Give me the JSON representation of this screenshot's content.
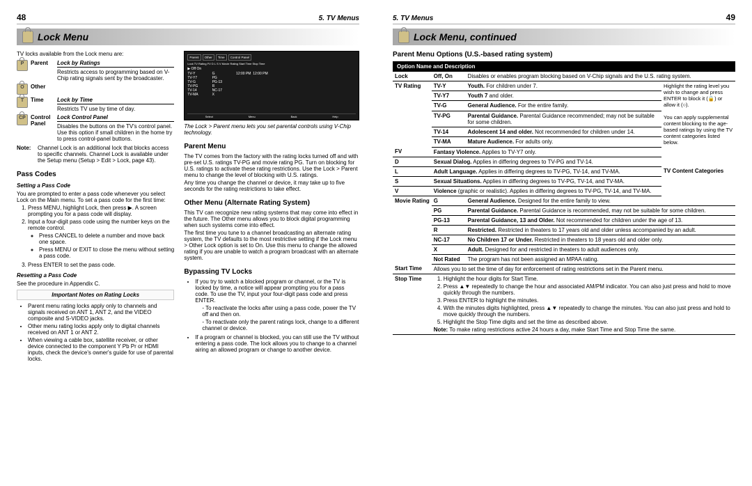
{
  "pages": {
    "left": {
      "num": "48",
      "section": "5. TV Menus",
      "title": "Lock Menu"
    },
    "right": {
      "num": "49",
      "section": "5. TV Menus",
      "title": "Lock Menu, continued"
    }
  },
  "intro": "TV locks available from the Lock menu are:",
  "lockTypes": [
    {
      "ltr": "P",
      "label": "Parent",
      "hd": "Lock by Ratings",
      "desc": "Restricts access to programming based on V-Chip rating signals sent by the broadcaster."
    },
    {
      "ltr": "O",
      "label": "Other",
      "hd": "",
      "desc": ""
    },
    {
      "ltr": "T",
      "label": "Time",
      "hd": "Lock by Time",
      "desc": "Restricts TV use by time of day."
    },
    {
      "ltr": "CP",
      "label": "Control Panel",
      "hd": "Lock Control Panel",
      "desc": "Disables the buttons on the TV's control panel. Use this option if small children in the home try to press control-panel buttons."
    }
  ],
  "note1": {
    "label": "Note:",
    "text": "Channel Lock is an additional lock that blocks access to specific channels. Channel Lock is available under the Setup menu (Setup > Edit > Lock, page 43)."
  },
  "passCodes": {
    "hd": "Pass Codes",
    "settingHd": "Setting a Pass Code",
    "settingTxt": "You are prompted to enter a pass code whenever you select Lock on the Main menu. To set a pass code for the first time:",
    "steps": [
      "Press MENU, highlight Lock, then press ▶. A screen prompting you for a pass code will display.",
      "Input a four-digit pass code using the number keys on the remote control.",
      "Press ENTER to set the pass code."
    ],
    "bullets": [
      "Press CANCEL to delete a number and move back one space.",
      "Press MENU or EXIT to close the menu without setting a pass code."
    ],
    "resetHd": "Resetting a Pass Code",
    "resetTxt": "See the procedure in Appendix C."
  },
  "impNotes": {
    "hd": "Important Notes on Rating Locks",
    "items": [
      "Parent menu rating locks apply only to channels and signals received on ANT 1, ANT 2, and the VIDEO composite and S-VIDEO jacks.",
      "Other menu rating locks apply only to digital channels received on ANT 1 or ANT 2.",
      "When viewing a cable box, satellite receiver, or other device connected to the component Y Pb Pr or HDMI inputs, check the device's owner's guide for use of parental locks."
    ]
  },
  "screenCaption": "The Lock > Parent menu lets you set parental controls using V-Chip technology.",
  "scr": {
    "tabs": [
      "Parent",
      "Other",
      "Time",
      "Control Panel"
    ],
    "cols": "Lock  TV Rating  FV  D  L  S  V  Movie Rating  Start Time  Stop Time",
    "offon": "▶ Off    On",
    "ratingsL": [
      "TV-Y",
      "TV-Y7",
      "TV-G",
      "TV-PG",
      "TV-14",
      "TV-MA"
    ],
    "mv": [
      "G",
      "PG",
      "PG-13",
      "R",
      "NC-17",
      "X"
    ],
    "t1": "12:00 PM",
    "t2": "12:00 PM",
    "b": [
      "Select",
      "Menu",
      "Back",
      "Help"
    ]
  },
  "parentMenu": {
    "hd": "Parent Menu",
    "p1": "The TV comes from the factory with the rating locks turned off and with pre-set U.S. ratings TV-PG and movie rating PG. Turn on blocking for U.S. ratings to activate these rating restrictions. Use the Lock > Parent menu to change the level of blocking with U.S. ratings.",
    "p2": "Any time you change the channel or device, it may take up to five seconds for the rating restrictions to take effect."
  },
  "otherMenu": {
    "hd": "Other Menu (Alternate Rating System)",
    "p1": "This TV can recognize new rating systems that may come into effect in the future. The Other menu allows you to block digital programming when such systems come into effect.",
    "p2": "The first time you tune to a channel broadcasting an alternate rating system, the TV defaults to the most restrictive setting if the Lock menu > Other Lock option is set to On. Use this menu to change the allowed rating if you are unable to watch a program broadcast with an alternate system."
  },
  "bypass": {
    "hd": "Bypassing TV Locks",
    "b1": "If you try to watch a blocked program or channel, or the TV is locked by time, a notice will appear prompting you for a pass code. To use the TV, input your four-digit pass code and press ENTER.",
    "sub1": "To reactivate the locks after using a pass code, power the TV off and then on.",
    "sub2": "To reactivate only the parent ratings lock, change to a different channel or device.",
    "b2": "If a program or channel is blocked, you can still use the TV without entering a pass code. The lock allows you to change to a channel airing an allowed program or change to another device."
  },
  "rightHd": "Parent Menu Options (U.S.-based rating system)",
  "tblHd": "Option Name and Description",
  "lockRow": {
    "k": "Lock",
    "v": "Off, On",
    "d": "Disables or enables program blocking based on V-Chip signals and the U.S. rating system."
  },
  "tv_side": {
    "p1": "Highlight the rating level you wish to change and press ENTER to block it (",
    "ic1": "🔒",
    "mid": ") or allow it (",
    "ic2": "⦰",
    "p2": ").",
    "p3": "You can apply supplemental content blocking to the age-based ratings by using the TV content categories listed below."
  },
  "tvRating": [
    {
      "k": "TV-Y",
      "b": "Youth.",
      "d": "For children under 7."
    },
    {
      "k": "TV-Y7",
      "b": "Youth 7",
      "d": " and older."
    },
    {
      "k": "TV-G",
      "b": "General Audience.",
      "d": "For the entire family."
    },
    {
      "k": "TV-PG",
      "b": "Parental Guidance.",
      "d": "Parental Guidance recommended; may not be suitable for some children."
    },
    {
      "k": "TV-14",
      "b": "Adolescent 14 and older.",
      "d": "Not recommended for children under 14."
    },
    {
      "k": "TV-MA",
      "b": "Mature Audience.",
      "d": "For adults only."
    }
  ],
  "tvRatingLabel": "TV Rating",
  "tcHd": "TV Content Categories",
  "content": [
    {
      "k": "FV",
      "b": "Fantasy Violence.",
      "d": "Applies to TV-Y7 only."
    },
    {
      "k": "D",
      "b": "Sexual Dialog.",
      "d": "Applies in differing degrees to TV-PG and TV-14."
    },
    {
      "k": "L",
      "b": "Adult Language.",
      "d": "Applies in differing degrees to TV-PG, TV-14, and TV-MA."
    },
    {
      "k": "S",
      "b": "Sexual Situations.",
      "d": "Applies in differing degrees to TV-PG, TV-14, and TV-MA."
    },
    {
      "k": "V",
      "b": "Violence",
      "d": " (graphic or realistic). Applies in differing degrees to TV-PG, TV-14, and TV-MA."
    }
  ],
  "movieLabel": "Movie Rating",
  "movie": [
    {
      "k": "G",
      "b": "General Audience.",
      "d": "Designed for the entire family to view."
    },
    {
      "k": "PG",
      "b": "Parental Guidance.",
      "d": "Parental Guidance is recommended, may not be suitable for some children."
    },
    {
      "k": "PG-13",
      "b": "Parental Guidance, 13 and Older.",
      "d": "Not recommended for children under the age of 13."
    },
    {
      "k": "R",
      "b": "Restricted.",
      "d": "Restricted in theaters to 17 years old and older unless accompanied by an adult."
    },
    {
      "k": "NC-17",
      "b": "No Children 17 or Under.",
      "d": "Restricted in theaters to 18 years old and older only."
    },
    {
      "k": "X",
      "b": "Adult.",
      "d": "Designed for and restricted in theaters to adult audiences only."
    },
    {
      "k": "Not Rated",
      "b": "",
      "d": "The program has not been assigned an MPAA rating."
    }
  ],
  "startTime": {
    "k": "Start Time",
    "d": "Allows you to set the time of day for enforcement of rating restrictions set in the Parent menu."
  },
  "stopTime": {
    "k": "Stop Time",
    "steps": [
      "Highlight the hour digits for Start Time.",
      "Press ▲▼ repeatedly to change the hour and associated AM/PM indicator. You can also just press and hold to move quickly through the numbers.",
      "Press ENTER to highlight the minutes.",
      "With the minutes digits highlighted, press ▲▼ repeatedly to change the minutes. You can also just press and hold to move quickly through the numbers.",
      "Highlight the Stop Time digits and set the time as described above."
    ],
    "note": "To make rating restrictions active 24 hours a day, make Start Time and Stop Time the same.",
    "noteLabel": "Note:"
  }
}
